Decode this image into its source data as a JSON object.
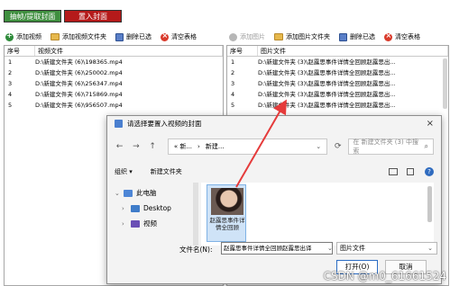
{
  "tabs": [
    {
      "label": "抽帧/提取封面",
      "color": "#3f8f3f"
    },
    {
      "label": "置入封面",
      "color": "#b51a1a"
    }
  ],
  "left_toolbar": {
    "add_video": "添加视频",
    "add_video_folder": "添加视频文件夹",
    "delete_selected": "删除已选",
    "clear_table": "清空表格"
  },
  "right_toolbar": {
    "add_image": "添加图片",
    "add_image_folder": "添加图片文件夹",
    "delete_selected": "删除已选",
    "clear_table": "清空表格"
  },
  "left_table": {
    "headers": [
      "序号",
      "视频文件"
    ],
    "rows": [
      {
        "no": "1",
        "file": "D:\\新建文件夹 (6)\\198365.mp4"
      },
      {
        "no": "2",
        "file": "D:\\新建文件夹 (6)\\250002.mp4"
      },
      {
        "no": "3",
        "file": "D:\\新建文件夹 (6)\\256347.mp4"
      },
      {
        "no": "4",
        "file": "D:\\新建文件夹 (6)\\715869.mp4"
      },
      {
        "no": "5",
        "file": "D:\\新建文件夹 (6)\\956507.mp4"
      }
    ]
  },
  "right_table": {
    "headers": [
      "序号",
      "图片文件"
    ],
    "rows": [
      {
        "no": "1",
        "file": "D:\\新建文件夹 (3)\\赵露思事件详情全回顾赵露思出..."
      },
      {
        "no": "2",
        "file": "D:\\新建文件夹 (3)\\赵露思事件详情全回顾赵露思出..."
      },
      {
        "no": "3",
        "file": "D:\\新建文件夹 (3)\\赵露思事件详情全回顾赵露思出..."
      },
      {
        "no": "4",
        "file": "D:\\新建文件夹 (3)\\赵露思事件详情全回顾赵露思出..."
      },
      {
        "no": "5",
        "file": "D:\\新建文件夹 (3)\\赵露思事件详情全回顾赵露思出..."
      }
    ]
  },
  "dialog": {
    "title": "请选择要置入视频的封面",
    "close": "×",
    "nav_back": "←",
    "nav_forward": "→",
    "nav_up": "↑",
    "nav_refresh": "⟳",
    "addr_ellipsis": "«  新...",
    "addr_sep": "›",
    "addr_folder": "新建...",
    "addr_chev": "⌄",
    "search_placeholder": "在 新建文件夹 (3) 中搜索",
    "organize": "组织 ▾",
    "new_folder": "新建文件夹",
    "help": "?",
    "tree": [
      {
        "label": "此电脑",
        "arrow": "⌄",
        "icon": "computer-icon"
      },
      {
        "label": "Desktop",
        "arrow": "›",
        "icon": "desktop-folder-icon"
      },
      {
        "label": "视频",
        "arrow": "›",
        "icon": "videos-folder-icon"
      }
    ],
    "thumbnail_caption": "赵露思事件详情全回顾",
    "filename_label": "文件名(N):",
    "filename_value": "赵露思事件详情全回顾赵露思出译",
    "filetype": "图片文件",
    "open_button": "打开(O)",
    "cancel_button": "取消"
  },
  "watermark": "CSDN @m0_61661524",
  "colors": {
    "arrow": "#e53b3b",
    "selection": "#cfe3f7"
  }
}
